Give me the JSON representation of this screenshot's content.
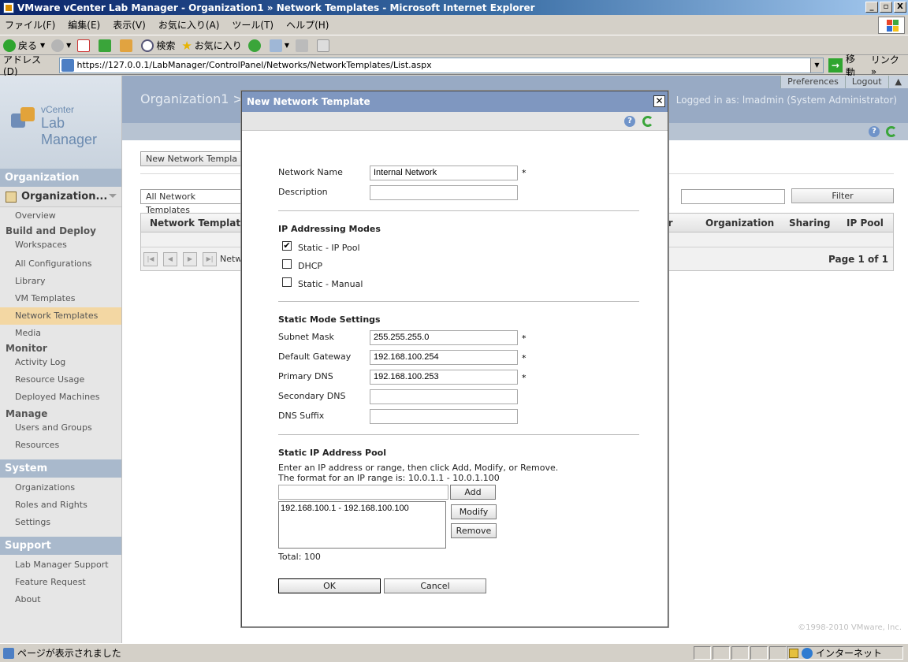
{
  "window": {
    "title": "VMware vCenter Lab Manager - Organization1 » Network Templates - Microsoft Internet Explorer",
    "controls": [
      "_",
      "▫",
      "X"
    ]
  },
  "menu": [
    "ファイル(F)",
    "編集(E)",
    "表示(V)",
    "お気に入り(A)",
    "ツール(T)",
    "ヘルプ(H)"
  ],
  "toolbar": {
    "back": "戻る",
    "search": "検索",
    "favorites": "お気に入り"
  },
  "address": {
    "label": "アドレス(D)",
    "url": "https://127.0.0.1/LabManager/ControlPanel/Networks/NetworkTemplates/List.aspx",
    "go": "移動",
    "links": "リンク"
  },
  "logo": {
    "line1": "vCenter",
    "line2": "Lab Manager"
  },
  "header": {
    "org_title": "Organization1 >",
    "preferences": "Preferences",
    "logout": "Logout",
    "logged_in": "Logged in as: lmadmin (System Administrator)"
  },
  "sidebar": {
    "organization_title": "Organization",
    "org_select": "Organization...",
    "overview": "Overview",
    "build_deploy": "Build and Deploy",
    "build_items": [
      "Workspaces",
      "All Configurations",
      "Library",
      "VM Templates",
      "Network Templates",
      "Media"
    ],
    "monitor": "Monitor",
    "monitor_items": [
      "Activity Log",
      "Resource Usage",
      "Deployed Machines"
    ],
    "manage": "Manage",
    "manage_items": [
      "Users and Groups",
      "Resources"
    ],
    "system_title": "System",
    "system_items": [
      "Organizations",
      "Roles and Rights",
      "Settings"
    ],
    "support_title": "Support",
    "support_items": [
      "Lab Manager Support",
      "Feature Request",
      "About"
    ]
  },
  "main": {
    "new_button": "New Network Templa",
    "filter_select": "All Network Templates",
    "filter_hint": "s",
    "filter_button": "Filter",
    "columns": [
      "Network Template",
      "ner",
      "Organization",
      "Sharing",
      "IP Pool"
    ],
    "pager_text": "Netw",
    "page_info": "Page 1 of 1",
    "copyright": "©1998-2010 VMware, Inc."
  },
  "dialog": {
    "title": "New Network Template",
    "network_name_label": "Network Name",
    "network_name_value": "Internal Network",
    "description_label": "Description",
    "description_value": "",
    "required_mark": "*",
    "ip_modes_title": "IP Addressing Modes",
    "mode_static_pool": "Static - IP Pool",
    "mode_dhcp": "DHCP",
    "mode_static_manual": "Static - Manual",
    "static_settings_title": "Static Mode Settings",
    "subnet_label": "Subnet Mask",
    "subnet_value": "255.255.255.0",
    "gateway_label": "Default Gateway",
    "gateway_value": "192.168.100.254",
    "pdns_label": "Primary DNS",
    "pdns_value": "192.168.100.253",
    "sdns_label": "Secondary DNS",
    "sdns_value": "",
    "suffix_label": "DNS Suffix",
    "suffix_value": "",
    "pool_title": "Static IP Address Pool",
    "pool_help1": "Enter an IP address or range, then click Add, Modify, or Remove.",
    "pool_help2": "The format for an IP range is: 10.0.1.1 - 10.0.1.100",
    "add_button": "Add",
    "modify_button": "Modify",
    "remove_button": "Remove",
    "pool_items": [
      "192.168.100.1 - 192.168.100.100"
    ],
    "total": "Total: 100",
    "ok_button": "OK",
    "cancel_button": "Cancel",
    "static_pool_checked": "✔"
  },
  "status": {
    "text": "ページが表示されました",
    "zone": "インターネット"
  }
}
